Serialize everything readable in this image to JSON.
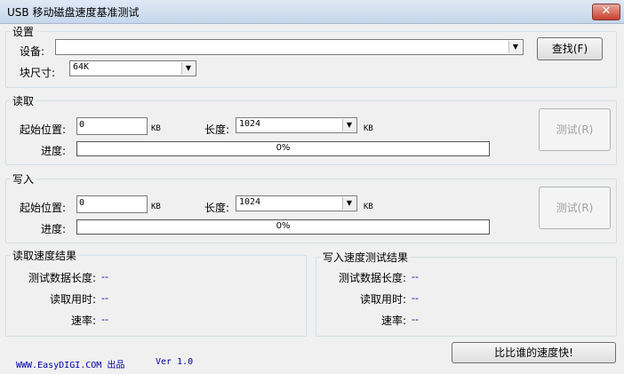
{
  "window": {
    "title": "USB 移动磁盘速度基准测试",
    "close_glyph": "✕"
  },
  "settings": {
    "legend": "设置",
    "device_label": "设备:",
    "device_value": "",
    "find_button": "查找(F)",
    "block_label": "块尺寸:",
    "block_value": "64K"
  },
  "read": {
    "legend": "读取",
    "start_label": "起始位置:",
    "start_value": "0",
    "start_unit": "KB",
    "length_label": "长度:",
    "length_value": "1024",
    "length_unit": "KB",
    "progress_label": "进度:",
    "progress_text": "0%",
    "progress_fraction": 0,
    "test_button": "测试(R)"
  },
  "write": {
    "legend": "写入",
    "start_label": "起始位置:",
    "start_value": "0",
    "start_unit": "KB",
    "length_label": "长度:",
    "length_value": "1024",
    "length_unit": "KB",
    "progress_label": "进度:",
    "progress_text": "0%",
    "progress_fraction": 0,
    "test_button": "测试(R)"
  },
  "read_results": {
    "legend": "读取速度结果",
    "length_label": "测试数据长度:",
    "length_value": "--",
    "time_label": "读取用时:",
    "time_value": "--",
    "rate_label": "速率:",
    "rate_value": "--"
  },
  "write_results": {
    "legend": "写入速度测试结果",
    "length_label": "测试数据长度:",
    "length_value": "--",
    "time_label": "读取用时:",
    "time_value": "--",
    "rate_label": "速率:",
    "rate_value": "--"
  },
  "footer": {
    "site": "WWW.EasyDIGI.COM 出品",
    "version": "Ver 1.0",
    "compare_button": "比比谁的速度快!"
  },
  "icons": {
    "dropdown": "▼"
  }
}
